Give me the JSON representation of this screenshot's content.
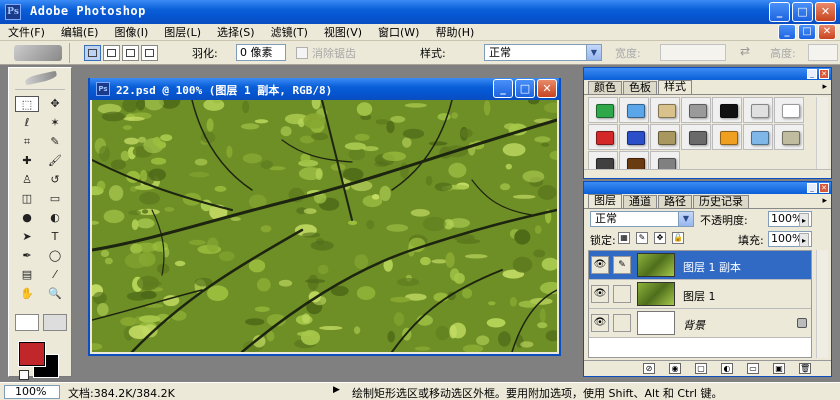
{
  "app": {
    "title": "Adobe Photoshop",
    "logo_text": "Ps",
    "window_buttons": {
      "minimize": "_",
      "maximize": "□",
      "close": "✕"
    }
  },
  "menubar": {
    "items": [
      "文件(F)",
      "编辑(E)",
      "图像(I)",
      "图层(L)",
      "选择(S)",
      "滤镜(T)",
      "视图(V)",
      "窗口(W)",
      "帮助(H)"
    ]
  },
  "options": {
    "feather_label": "羽化:",
    "feather_value": "0 像素",
    "antialias_label": "消除锯齿",
    "style_label": "样式:",
    "style_value": "正常",
    "width_label": "宽度:",
    "height_label": "高度:",
    "swap_icon": "⇄"
  },
  "toolbox": {
    "tools": [
      {
        "name": "marquee-tool",
        "glyph": "⬚",
        "active": true
      },
      {
        "name": "move-tool",
        "glyph": "✥",
        "active": false
      },
      {
        "name": "lasso-tool",
        "glyph": "ℓ",
        "active": false
      },
      {
        "name": "magic-wand-tool",
        "glyph": "✶",
        "active": false
      },
      {
        "name": "crop-tool",
        "glyph": "⌗",
        "active": false
      },
      {
        "name": "slice-tool",
        "glyph": "✎",
        "active": false
      },
      {
        "name": "healing-brush-tool",
        "glyph": "✚",
        "active": false
      },
      {
        "name": "brush-tool",
        "glyph": "🖌",
        "active": false
      },
      {
        "name": "clone-stamp-tool",
        "glyph": "♙",
        "active": false
      },
      {
        "name": "history-brush-tool",
        "glyph": "↺",
        "active": false
      },
      {
        "name": "eraser-tool",
        "glyph": "◫",
        "active": false
      },
      {
        "name": "gradient-tool",
        "glyph": "▭",
        "active": false
      },
      {
        "name": "blur-tool",
        "glyph": "●",
        "active": false
      },
      {
        "name": "dodge-tool",
        "glyph": "◐",
        "active": false
      },
      {
        "name": "path-select-tool",
        "glyph": "➤",
        "active": false
      },
      {
        "name": "type-tool",
        "glyph": "T",
        "active": false
      },
      {
        "name": "pen-tool",
        "glyph": "✒",
        "active": false
      },
      {
        "name": "shape-tool",
        "glyph": "◯",
        "active": false
      },
      {
        "name": "notes-tool",
        "glyph": "▤",
        "active": false
      },
      {
        "name": "eyedropper-tool",
        "glyph": "⁄",
        "active": false
      },
      {
        "name": "hand-tool",
        "glyph": "✋",
        "active": false
      },
      {
        "name": "zoom-tool",
        "glyph": "🔍",
        "active": false
      }
    ],
    "colors": {
      "foreground": "#c0262a",
      "background": "#000000"
    }
  },
  "document": {
    "title": "22.psd @ 100% (图层 1 副本, RGB/8)",
    "icon_text": "Ps"
  },
  "styles_panel": {
    "tabs": [
      "颜色",
      "色板",
      "样式"
    ],
    "active_tab": 2,
    "menu_glyph": "▸",
    "swatches": [
      "#2fa84a",
      "#5aa6e8",
      "#d8c18a",
      "#9a9a9a",
      "#111111",
      "#e0e0e0",
      "#ffffff",
      "#d42828",
      "#2a4fc8",
      "#a89860",
      "#6a6a6a",
      "#f0a020",
      "#7fb8e8",
      "#c0bca0",
      "#404040",
      "#6a3a10",
      "#808080"
    ]
  },
  "layers_panel": {
    "tabs": [
      "图层",
      "通道",
      "路径",
      "历史记录"
    ],
    "active_tab": 0,
    "menu_glyph": "▸",
    "blend_mode": "正常",
    "opacity_label": "不透明度:",
    "opacity_value": "100%",
    "lock_label": "锁定:",
    "lock_icons": [
      "▦",
      "✎",
      "✥",
      "🔒"
    ],
    "fill_label": "填充:",
    "fill_value": "100%",
    "layers": [
      {
        "name": "图层 1 副本",
        "thumb": "green",
        "selected": true,
        "visible": true,
        "linked_glyph": "✎",
        "locked": false,
        "italic": false
      },
      {
        "name": "图层 1",
        "thumb": "green",
        "selected": false,
        "visible": true,
        "linked_glyph": "",
        "locked": false,
        "italic": false
      },
      {
        "name": "背景",
        "thumb": "white",
        "selected": false,
        "visible": true,
        "linked_glyph": "",
        "locked": true,
        "italic": true
      }
    ],
    "footer_icons": [
      "⊘",
      "◉",
      "▢",
      "◐",
      "▭",
      "▣",
      "🗑"
    ]
  },
  "statusbar": {
    "zoom": "100%",
    "doc_info": "文档:384.2K/384.2K",
    "arrow": "▶",
    "hint": "绘制矩形选区或移动选区外框。要用附加选项，使用 Shift、Alt 和 Ctrl 键。"
  }
}
